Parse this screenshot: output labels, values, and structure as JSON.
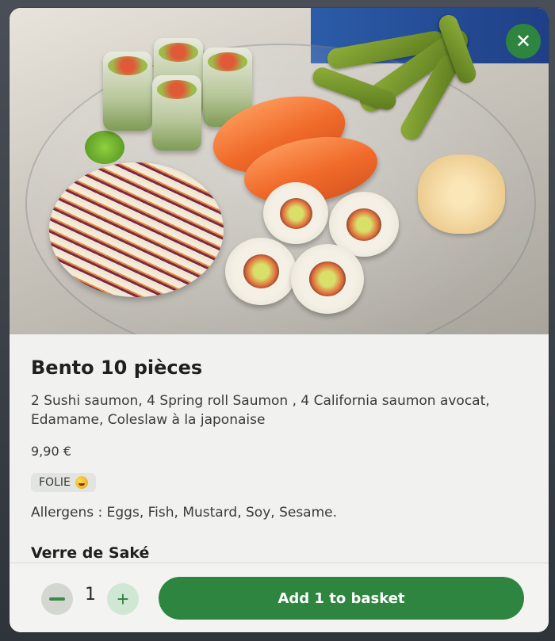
{
  "product": {
    "title": "Bento 10 pièces",
    "description": "2 Sushi saumon, 4 Spring roll Saumon , 4 California saumon avocat, Edamame, Coleslaw à la japonaise",
    "price": "9,90 €",
    "badge": "FOLIE",
    "badge_icon": "starstruck-emoji-icon",
    "allergens": "Allergens : Eggs, Fish, Mustard, Soy, Sesame.",
    "image_alt": "Bento box with sushi, spring rolls, edamame and coleslaw"
  },
  "next_section": {
    "title": "Verre de Saké"
  },
  "close_button": {
    "icon": "close-icon",
    "glyph": "✕"
  },
  "footer": {
    "quantity": "1",
    "minus_icon": "minus-icon",
    "plus_icon": "plus-icon",
    "plus_glyph": "+",
    "add_label": "Add 1 to basket"
  },
  "colors": {
    "accent": "#2e8540",
    "accent_light": "#cfe7d3",
    "background": "#f1f2f0"
  }
}
